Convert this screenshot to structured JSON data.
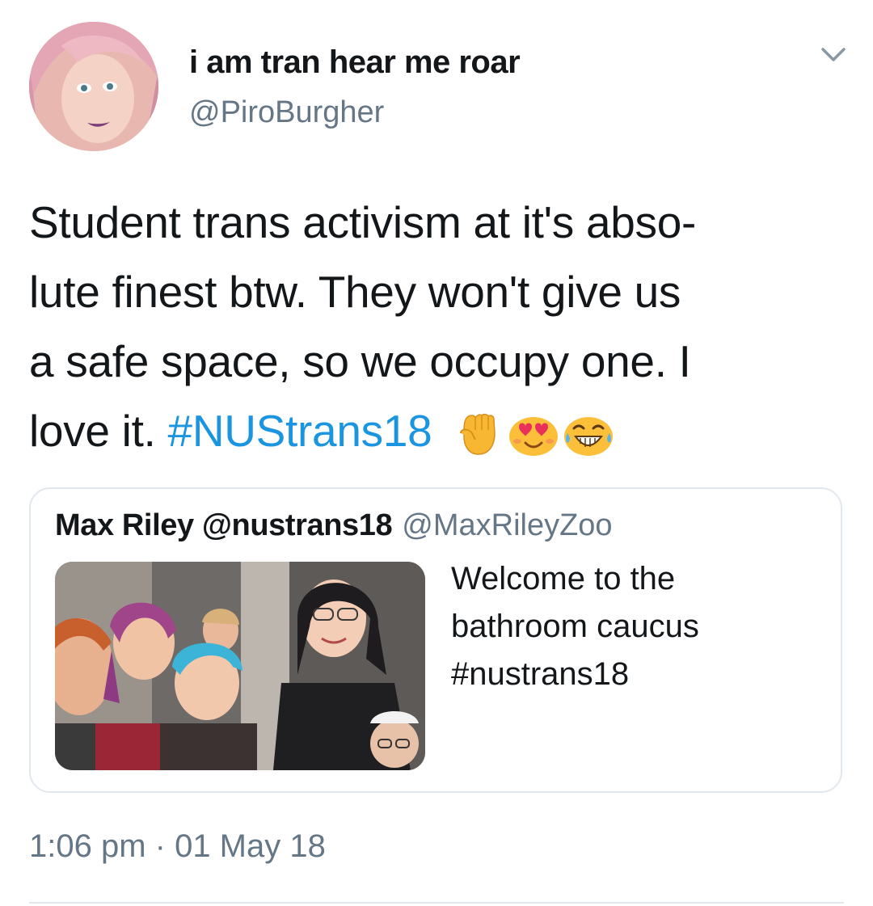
{
  "author": {
    "display_name": "i am tran hear me roar",
    "handle": "@PiroBurgher"
  },
  "tweet": {
    "lines": [
      "Student trans activism at it's abso-",
      "lute finest btw. They won't give us",
      "a safe space, so we occupy one. I"
    ],
    "last_line_text": "love it. ",
    "hashtag": "#NUStrans18",
    "emojis": [
      "raised-fist-emoji",
      "heart-eyes-emoji",
      "tears-of-joy-emoji"
    ]
  },
  "quoted_tweet": {
    "name": "Max Riley @nustrans18",
    "handle": "@MaxRileyZoo",
    "text_lines": [
      "Welcome to the",
      "bathroom caucus",
      "#nustrans18"
    ]
  },
  "timestamp": "1:06 pm · 01 May 18",
  "colors": {
    "hashtag": "#1b95e0",
    "secondary_text": "#657786",
    "border": "#e1e8ed"
  }
}
